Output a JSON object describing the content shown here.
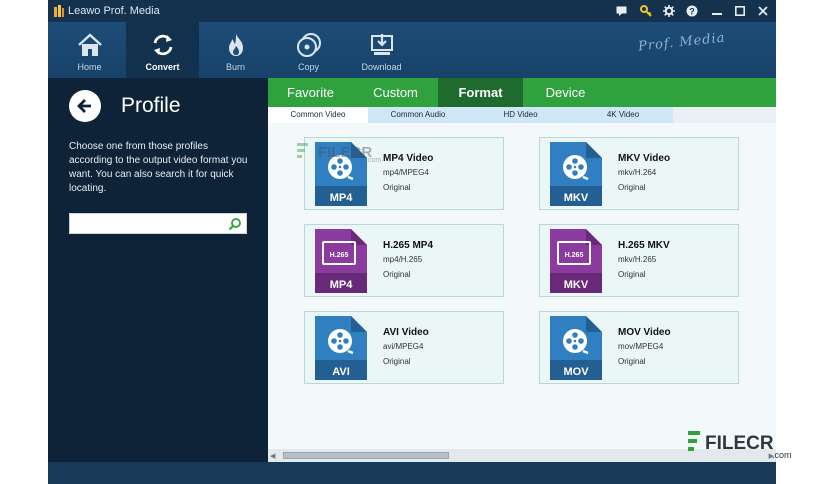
{
  "window": {
    "title": "Leawo Prof. Media",
    "controls": [
      "chat-icon",
      "key-icon",
      "gear-icon",
      "help-icon",
      "minimize-icon",
      "maximize-icon",
      "close-icon"
    ]
  },
  "toolbar": {
    "items": [
      {
        "label": "Home",
        "icon": "home-icon"
      },
      {
        "label": "Convert",
        "icon": "convert-icon",
        "active": true
      },
      {
        "label": "Burn",
        "icon": "burn-icon"
      },
      {
        "label": "Copy",
        "icon": "copy-icon"
      },
      {
        "label": "Download",
        "icon": "download-icon"
      }
    ],
    "brand": "Prof. Media"
  },
  "profile": {
    "title": "Profile",
    "description": "Choose one from those profiles according to the output video format you want. You can also search it for quick locating.",
    "search_placeholder": "",
    "search_value": ""
  },
  "tabs": [
    {
      "label": "Favorite"
    },
    {
      "label": "Custom"
    },
    {
      "label": "Format",
      "active": true
    },
    {
      "label": "Device"
    }
  ],
  "subtabs": [
    {
      "label": "Common Video",
      "active": true
    },
    {
      "label": "Common Audio"
    },
    {
      "label": "HD Video"
    },
    {
      "label": "4K Video"
    }
  ],
  "formats": [
    {
      "name": "MP4 Video",
      "codec": "mp4/MPEG4",
      "quality": "Original",
      "badge": "MP4",
      "tag": "",
      "color": "#2f7fc1"
    },
    {
      "name": "MKV Video",
      "codec": "mkv/H.264",
      "quality": "Original",
      "badge": "MKV",
      "tag": "",
      "color": "#2f7fc1"
    },
    {
      "name": "H.265 MP4",
      "codec": "mp4/H.265",
      "quality": "Original",
      "badge": "MP4",
      "tag": "H.265",
      "color": "#8b3a9e"
    },
    {
      "name": "H.265 MKV",
      "codec": "mkv/H.265",
      "quality": "Original",
      "badge": "MKV",
      "tag": "H.265",
      "color": "#8b3a9e"
    },
    {
      "name": "AVI Video",
      "codec": "avi/MPEG4",
      "quality": "Original",
      "badge": "AVI",
      "tag": "",
      "color": "#2f7fc1"
    },
    {
      "name": "MOV Video",
      "codec": "mov/MPEG4",
      "quality": "Original",
      "badge": "MOV",
      "tag": "",
      "color": "#2f7fc1"
    }
  ],
  "watermark": {
    "text": "FILECR",
    "domain": ".com"
  },
  "colors": {
    "tab_green": "#2fa23d",
    "tab_active": "#1e6a2f",
    "panel_dark": "#0e2338",
    "toolbar": "#1d4d78"
  }
}
